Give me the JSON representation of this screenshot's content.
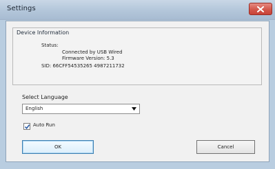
{
  "window": {
    "title": "Settings"
  },
  "device_info": {
    "group_title": "Device Information",
    "status_label": "Status:",
    "status_connection": "Connected by USB Wired",
    "firmware": "Firmware Version: 5.3",
    "sid": "SID: 66CFF54535265 4987211732"
  },
  "language": {
    "label": "Select Language",
    "selected": "English"
  },
  "auto_run": {
    "label": "Auto Run",
    "checked": true
  },
  "buttons": {
    "ok": "OK",
    "cancel": "Cancel"
  },
  "icons": {
    "close": "close-icon",
    "dropdown": "chevron-down-icon",
    "check": "checkmark-icon"
  },
  "colors": {
    "close_button": "#d3574b",
    "title_bar": "#b3c6da",
    "default_button_border": "#3c7fb1"
  }
}
